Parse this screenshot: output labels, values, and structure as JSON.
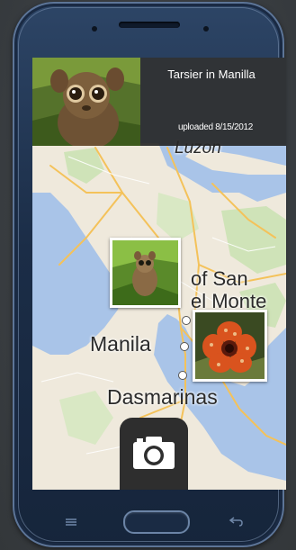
{
  "header": {
    "title": "Tarsier in Manilla",
    "uploaded": "uploaded 8/15/2012"
  },
  "map": {
    "labels": {
      "luzon": "Luzon",
      "san": "of San",
      "monte": "el Monte",
      "manila": "Manila",
      "dasmarinas": "Dasmarinas"
    }
  },
  "icons": {
    "camera": "camera-icon",
    "menu": "menu-icon",
    "back": "back-icon",
    "home": "home-button"
  }
}
